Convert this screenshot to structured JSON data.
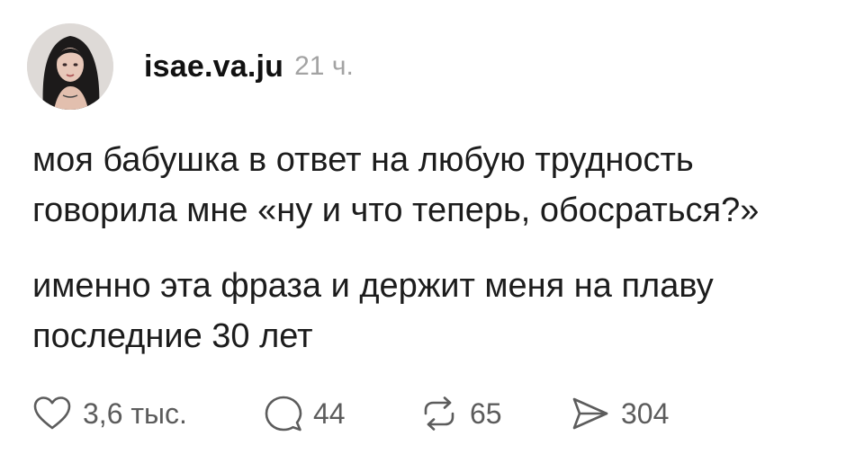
{
  "post": {
    "author": "isae.va.ju",
    "time": "21 ч.",
    "paragraphs": [
      "моя бабушка в ответ на любую трудность говорила мне «ну и что теперь, обосраться?»",
      "именно эта фраза и держит меня на плаву последние 30 лет"
    ]
  },
  "actions": {
    "likes": "3,6 тыс.",
    "replies": "44",
    "reposts": "65",
    "shares": "304"
  },
  "icons": {
    "like": "heart-icon",
    "reply": "speech-bubble-icon",
    "repost": "repost-arrows-icon",
    "share": "send-arrow-icon"
  },
  "colors": {
    "text": "#1c1c1c",
    "muted": "#a3a3a3",
    "icon": "#5c5c5c",
    "background": "#ffffff"
  }
}
